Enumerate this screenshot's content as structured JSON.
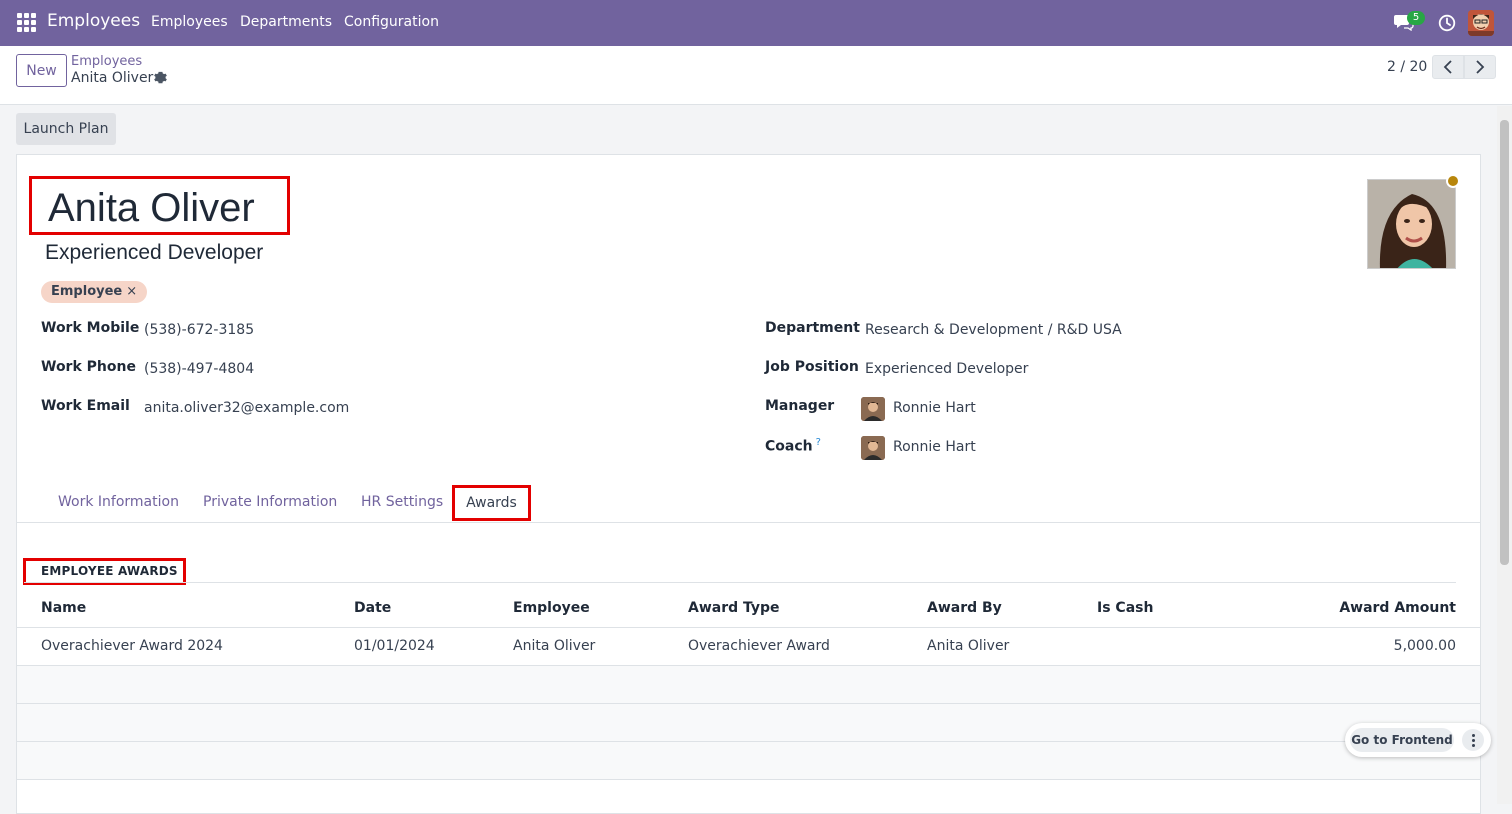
{
  "navbar": {
    "brand": "Employees",
    "menu": [
      "Employees",
      "Departments",
      "Configuration"
    ],
    "chat_count": "5",
    "accent": "#71639e"
  },
  "control_panel": {
    "new_label": "New",
    "breadcrumb_parent": "Employees",
    "breadcrumb_current": "Anita Oliver",
    "pager": "2 / 20"
  },
  "status_bar": {
    "launch_plan_label": "Launch Plan"
  },
  "employee": {
    "name": "Anita Oliver",
    "job_title": "Experienced Developer",
    "tag": "Employee",
    "tag_remove": "×",
    "fields_left": [
      {
        "label": "Work Mobile",
        "value": "(538)-672-3185"
      },
      {
        "label": "Work Phone",
        "value": "(538)-497-4804"
      },
      {
        "label": "Work Email",
        "value": "anita.oliver32@example.com"
      }
    ],
    "fields_right": [
      {
        "label": "Department",
        "value": "Research & Development / R&D USA"
      },
      {
        "label": "Job Position",
        "value": "Experienced Developer"
      },
      {
        "label": "Manager",
        "value": "Ronnie Hart"
      },
      {
        "label": "Coach",
        "value": "Ronnie Hart",
        "help": "?"
      }
    ]
  },
  "tabs": [
    "Work Information",
    "Private Information",
    "HR Settings",
    "Awards"
  ],
  "awards": {
    "section_title": "EMPLOYEE AWARDS",
    "columns": [
      "Name",
      "Date",
      "Employee",
      "Award Type",
      "Award By",
      "Is Cash",
      "Award Amount"
    ],
    "rows": [
      {
        "name": "Overachiever Award 2024",
        "date": "01/01/2024",
        "employee": "Anita Oliver",
        "award_type": "Overachiever Award",
        "award_by": "Anita Oliver",
        "is_cash": "",
        "amount": "5,000.00"
      }
    ]
  },
  "floating": {
    "frontend_label": "Go to Frontend"
  }
}
